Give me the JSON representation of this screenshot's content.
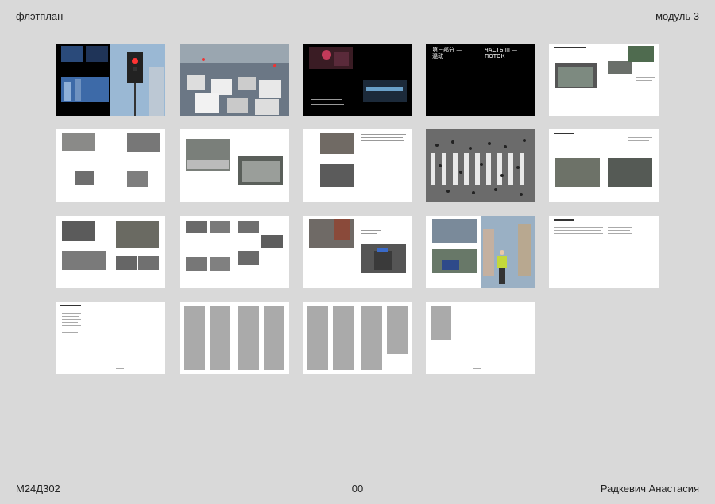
{
  "header": {
    "left": "флэтплан",
    "right": "модуль 3"
  },
  "footer": {
    "left": "М24Д302",
    "center": "00",
    "right": "Радкевич Анастасия"
  },
  "part_title": {
    "zh_line1": "第三部分 —",
    "zh_line2": "混动",
    "ru_line1": "ЧАСТЬ III —",
    "ru_line2": "ПОТОК"
  }
}
